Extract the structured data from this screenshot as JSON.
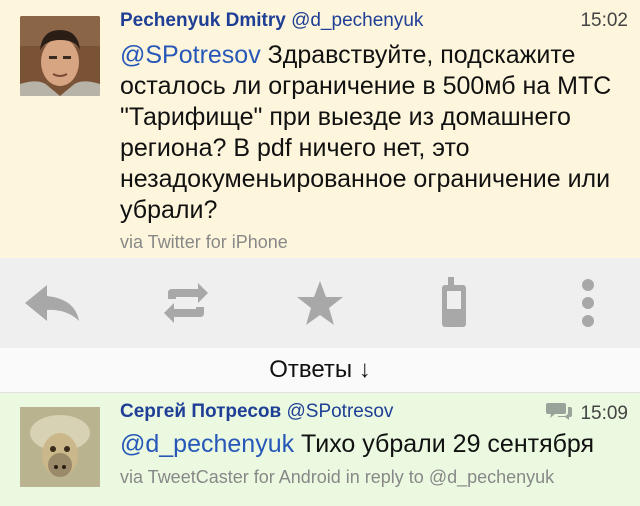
{
  "tweet": {
    "author_name": "Pechenyuk Dmitry",
    "author_handle": "@d_pechenyuk",
    "time": "15:02",
    "mention": "@SPotresov",
    "text": " Здравствуйте, подскажите осталось ли ограничение в 500мб на МТС \"Тарифище\" при выезде из домашнего региона? В pdf ничего нет, это незадокуменьированное ограничение или убрали?",
    "via": "via Twitter for iPhone"
  },
  "actions": [
    {
      "name": "reply",
      "icon": "reply-icon"
    },
    {
      "name": "retweet",
      "icon": "retweet-icon"
    },
    {
      "name": "favorite",
      "icon": "star-icon"
    },
    {
      "name": "phone",
      "icon": "phone-icon"
    },
    {
      "name": "more",
      "icon": "more-vertical-icon"
    }
  ],
  "replies_header": "Ответы ↓",
  "reply": {
    "author_name": "Сергей Потресов",
    "author_handle": "@SPotresov",
    "time": "15:09",
    "mention": "@d_pechenyuk",
    "text": " Тихо убрали 29 сентября",
    "via": "via TweetCaster for Android in reply to @d_pechenyuk"
  },
  "colors": {
    "main_bg": "#fdf6dc",
    "reply_bg": "#eaf9e0",
    "link": "#1e3f95",
    "icon": "#a8a8a8"
  }
}
